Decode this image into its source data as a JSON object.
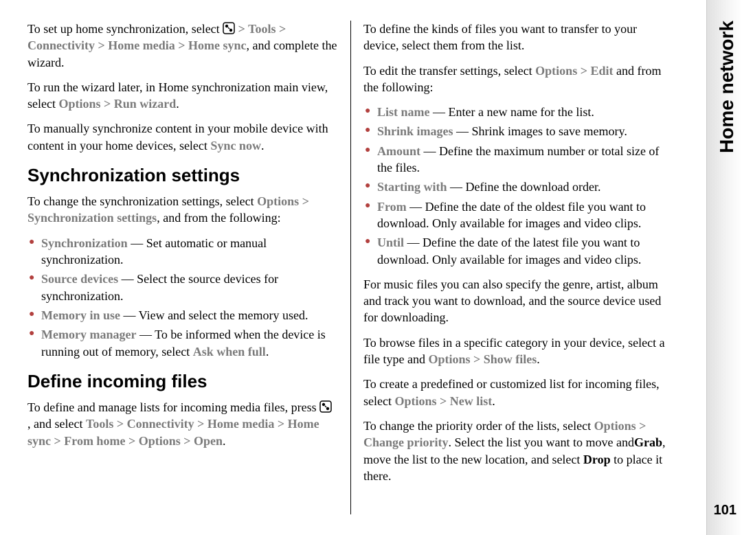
{
  "sidebar": {
    "title": "Home network"
  },
  "pageNumber": "101",
  "col1": {
    "p1_a": "To set up home synchronization, select ",
    "p1_gt": " > ",
    "p1_tools": "Tools",
    "p1_conn": "Connectivity",
    "p1_hm": "Home media",
    "p1_hs": "Home sync",
    "p1_b": ", and complete the wizard.",
    "p2_a": "To run the wizard later, in Home synchronization main view, select ",
    "p2_opt": "Options",
    "p2_gt": " > ",
    "p2_run": "Run wizard",
    "p2_b": ".",
    "p3_a": "To manually synchronize content in your mobile device with content in your home devices, select ",
    "p3_sync": "Sync now",
    "p3_b": ".",
    "h1": "Synchronization settings",
    "p4_a": "To change the synchronization settings, select ",
    "p4_opt": "Options",
    "p4_gt": " > ",
    "p4_ss": "Synchronization settings",
    "p4_b": ", and from the following:",
    "list1": [
      {
        "term": "Synchronization",
        "desc": " — Set automatic or manual synchronization."
      },
      {
        "term": "Source devices",
        "desc": " — Select the source devices for synchronization."
      },
      {
        "term": "Memory in use",
        "desc": " — View and select the memory used."
      },
      {
        "term": "Memory manager",
        "desc_a": " — To be informed when the device is running out of memory, select ",
        "term2": "Ask when full",
        "desc_b": "."
      }
    ],
    "h2": "Define incoming files",
    "p5_a": "To define and manage lists for incoming media files, press ",
    "p5_b": " , and select ",
    "p5_tools": "Tools",
    "p5_gt": " > ",
    "p5_conn": "Connectivity",
    "p5_hm": "Home media",
    "p5_hs": "Home sync",
    "p5_fh": "From home",
    "p5_opt": "Options",
    "p5_open": "Open",
    "p5_c": "."
  },
  "col2": {
    "p1": "To define the kinds of files you want to transfer to your device, select them from the list.",
    "p2_a": "To edit the transfer settings, select ",
    "p2_opt": "Options",
    "p2_gt": " > ",
    "p2_edit": "Edit",
    "p2_b": " and from the following:",
    "list1": [
      {
        "term": "List name",
        "desc": " — Enter a new name for the list."
      },
      {
        "term": "Shrink images",
        "desc": " — Shrink images to save memory."
      },
      {
        "term": "Amount",
        "desc": " — Define the maximum number or total size of the files."
      },
      {
        "term": "Starting with",
        "desc": " — Define the download order."
      },
      {
        "term": "From",
        "desc": " — Define the date of the oldest file you want to download. Only available for images and video clips."
      },
      {
        "term": "Until",
        "desc": " — Define the date of the latest file you want to download. Only available for images and video clips."
      }
    ],
    "p3": "For music files you can also specify the genre, artist, album and track you want to download, and the source device used for downloading.",
    "p4_a": "To browse files in a specific category in your device, select a file type and ",
    "p4_opt": "Options",
    "p4_gt": " > ",
    "p4_show": "Show files",
    "p4_b": ".",
    "p5_a": "To create a predefined or customized list for incoming files, select ",
    "p5_opt": "Options",
    "p5_gt": " > ",
    "p5_new": "New list",
    "p5_b": ".",
    "p6_a": "To change the priority order of the lists, select ",
    "p6_opt": "Options",
    "p6_gt": " > ",
    "p6_cp": "Change priority",
    "p6_b": ". Select the list you want to move and",
    "p6_grab": "Grab",
    "p6_c": ", move the list to the new location, and select ",
    "p6_drop": "Drop",
    "p6_d": " to place it there."
  }
}
